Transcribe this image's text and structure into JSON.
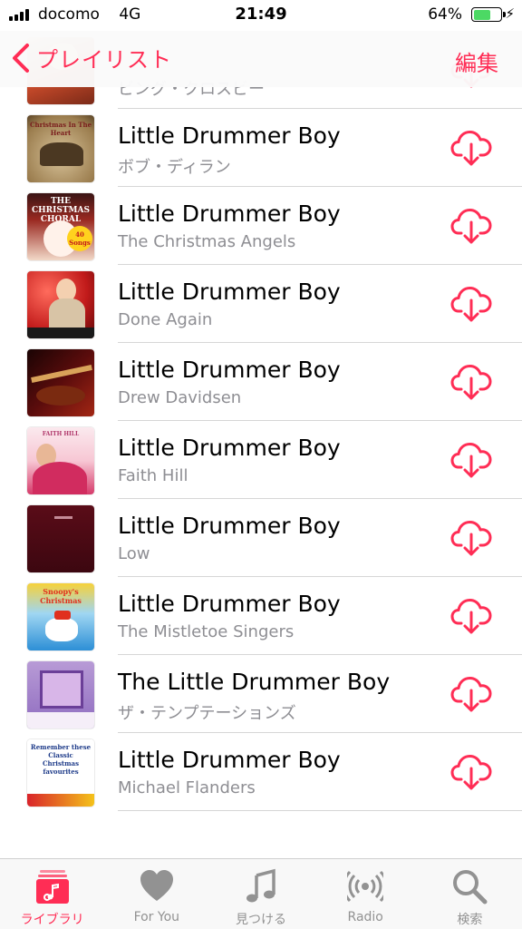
{
  "status": {
    "carrier": "docomo",
    "network": "4G",
    "time": "21:49",
    "battery": "64%",
    "battery_level": 0.64,
    "battery_color": "#4cd964"
  },
  "nav": {
    "back_label": "プレイリスト",
    "edit_label": "編集",
    "accent": "#ff2d55"
  },
  "songs": [
    {
      "title": "",
      "artist": "ビング・クロスビー",
      "art": "bing"
    },
    {
      "title": "Little Drummer Boy",
      "artist": "ボブ・ディラン",
      "art": "dylan",
      "art_text": "Christmas In The Heart"
    },
    {
      "title": "Little Drummer Boy",
      "artist": "The Christmas Angels",
      "art": "choral",
      "art_text": "THE CHRISTMAS CHORAL",
      "art_badge": "40 Songs"
    },
    {
      "title": "Little Drummer Boy",
      "artist": "Done Again",
      "art": "done"
    },
    {
      "title": "Little Drummer Boy",
      "artist": "Drew Davidsen",
      "art": "drew"
    },
    {
      "title": "Little Drummer Boy",
      "artist": "Faith Hill",
      "art": "faith",
      "art_text": "FAITH HILL"
    },
    {
      "title": "Little Drummer Boy",
      "artist": "Low",
      "art": "low"
    },
    {
      "title": "Little Drummer Boy",
      "artist": "The Mistletoe Singers",
      "art": "snoopy",
      "art_text": "Snoopy's Christmas"
    },
    {
      "title": "The Little Drummer Boy",
      "artist": "ザ・テンプテーションズ",
      "art": "temptations"
    },
    {
      "title": "Little Drummer Boy",
      "artist": "Michael Flanders",
      "art": "flanders",
      "art_text": "Remember these Classic Christmas favourites"
    }
  ],
  "tabs": [
    {
      "label": "ライブラリ",
      "icon": "library-icon",
      "active": true
    },
    {
      "label": "For You",
      "icon": "heart-icon",
      "active": false
    },
    {
      "label": "見つける",
      "icon": "music-note-icon",
      "active": false
    },
    {
      "label": "Radio",
      "icon": "radio-icon",
      "active": false
    },
    {
      "label": "検索",
      "icon": "search-icon",
      "active": false
    }
  ]
}
